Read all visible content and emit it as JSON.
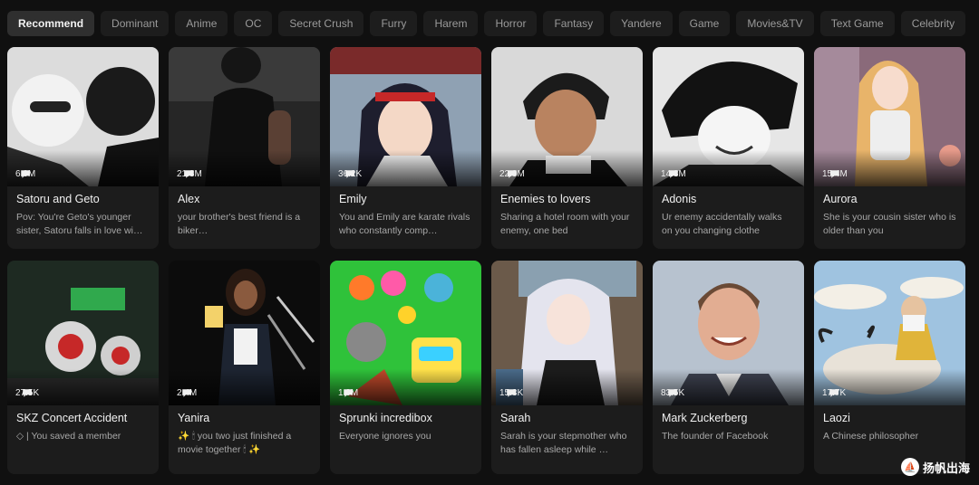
{
  "tabs": [
    {
      "label": "Recommend",
      "active": true
    },
    {
      "label": "Dominant"
    },
    {
      "label": "Anime"
    },
    {
      "label": "OC"
    },
    {
      "label": "Secret Crush"
    },
    {
      "label": "Furry"
    },
    {
      "label": "Harem"
    },
    {
      "label": "Horror"
    },
    {
      "label": "Fantasy"
    },
    {
      "label": "Yandere"
    },
    {
      "label": "Game"
    },
    {
      "label": "Movies&TV"
    },
    {
      "label": "Text Game"
    },
    {
      "label": "Celebrity"
    }
  ],
  "cards_row1": [
    {
      "count": "6.9M",
      "name": "Satoru and Geto",
      "desc": "Pov: You're Geto's younger sister, Satoru falls in love wi…",
      "icon": "chat-bubble-icon"
    },
    {
      "count": "21.3M",
      "name": "Alex",
      "desc": "your brother's best friend is a biker…",
      "icon": "chat-bubble-icon"
    },
    {
      "count": "36.2K",
      "name": "Emily",
      "desc": "You and Emily are karate rivals who constantly comp…",
      "icon": "chat-bubble-icon"
    },
    {
      "count": "22.9M",
      "name": "Enemies to lovers",
      "desc": "Sharing a hotel room with your enemy, one bed",
      "icon": "chat-bubble-icon"
    },
    {
      "count": "14.3M",
      "name": "Adonis",
      "desc": "Ur enemy accidentally walks on you changing clothe",
      "icon": "chat-bubble-icon"
    },
    {
      "count": "15.4M",
      "name": "Aurora",
      "desc": "She is your cousin sister who is older than you",
      "icon": "chat-bubble-icon"
    }
  ],
  "cards_row2": [
    {
      "count": "27.5K",
      "name": "SKZ Concert Accident",
      "desc": "◇ | You saved a member",
      "icon": "chat-bubble-icon"
    },
    {
      "count": "2.4M",
      "name": "Yanira",
      "desc": "✨ 🕯 you two just finished a movie together 🕯 ✨",
      "icon": "chat-bubble-icon"
    },
    {
      "count": "1.9M",
      "name": "Sprunki incredibox",
      "desc": "Everyone ignores you",
      "icon": "chat-bubble-icon"
    },
    {
      "count": "15.8K",
      "name": "Sarah",
      "desc": "Sarah is your stepmother who has fallen asleep while …",
      "icon": "chat-bubble-icon"
    },
    {
      "count": "83.5K",
      "name": "Mark Zuckerberg",
      "desc": "The founder of Facebook",
      "icon": "chat-bubble-icon"
    },
    {
      "count": "17.7K",
      "name": "Laozi",
      "desc": "A Chinese philosopher",
      "icon": "chat-bubble-icon"
    }
  ],
  "watermark": {
    "text": "扬帆出海",
    "icon": "sail-logo-icon"
  },
  "colors": {
    "background": "#101010",
    "card": "#1c1c1c",
    "tab": "#1d1d1d",
    "tab_active": "#2f2f2f"
  }
}
